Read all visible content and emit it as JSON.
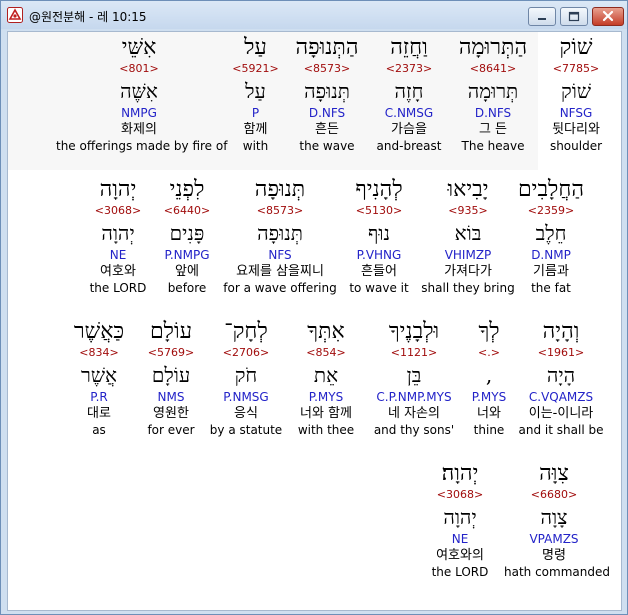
{
  "window": {
    "title": "@원전분해 - 레 10:15",
    "buttons": [
      "minimize",
      "maximize",
      "close"
    ]
  },
  "colors": {
    "strong_number": "#a10d0d",
    "morphology": "#2323c8",
    "text": "#000000"
  },
  "rows": [
    {
      "words": [
        {
          "hebrew": "שׁוֹק",
          "strong": "<7785>",
          "lemma": "שׁוֹק",
          "morph": "NFSG",
          "korean": "뒷다리와",
          "english": "shoulder"
        },
        {
          "hebrew": "הַתְּרוּמָה",
          "strong": "<8641>",
          "lemma": "תְּרוּמָה",
          "morph": "D.NFS",
          "korean": "그 든",
          "english": "The heave"
        },
        {
          "hebrew": "וַחֲזֵה",
          "strong": "<2373>",
          "lemma": "חָזֶה",
          "morph": "C.NMSG",
          "korean": "가슴을",
          "english": "and-breast"
        },
        {
          "hebrew": "הַתְּנוּפָה",
          "strong": "<8573>",
          "lemma": "תְּנוּפָה",
          "morph": "D.NFS",
          "korean": "흔든",
          "english": "the wave"
        },
        {
          "hebrew": "עַל",
          "strong": "<5921>",
          "lemma": "עַל",
          "morph": "P",
          "korean": "함께",
          "english": "with"
        },
        {
          "hebrew": "אִשֵּׁי",
          "strong": "<801>",
          "lemma": "אִשֶּׁה",
          "morph": "NMPG",
          "korean": "화제의",
          "english": "the offerings made by fire of"
        }
      ]
    },
    {
      "words": [
        {
          "hebrew": "הַחֲלָבִים",
          "strong": "<2359>",
          "lemma": "חֵלֶב",
          "morph": "D.NMP",
          "korean": "기름과",
          "english": "the fat"
        },
        {
          "hebrew": "יָבִיאוּ",
          "strong": "<935>",
          "lemma": "בּוֹא",
          "morph": "VHIMZP",
          "korean": "가져다가",
          "english": "shall they bring"
        },
        {
          "hebrew": "לְהָנִיף",
          "strong": "<5130>",
          "lemma": "נוּף",
          "morph": "P.VHNG",
          "korean": "흔들어",
          "english": "to wave it"
        },
        {
          "hebrew": "תְּנוּפָה",
          "strong": "<8573>",
          "lemma": "תְּנוּפָה",
          "morph": "NFS",
          "korean": "요제를 삼을찌니",
          "english": "for a wave offering"
        },
        {
          "hebrew": "לִפְנֵי",
          "strong": "<6440>",
          "lemma": "פָּנִים",
          "morph": "P.NMPG",
          "korean": "앞에",
          "english": "before"
        },
        {
          "hebrew": "יְהוָה",
          "strong": "<3068>",
          "lemma": "יְהוָה",
          "morph": "NE",
          "korean": "여호와",
          "english": "the LORD"
        }
      ]
    },
    {
      "words": [
        {
          "hebrew": "וְהָיָה",
          "strong": "<1961>",
          "lemma": "הָיָה",
          "morph": "C.VQAMZS",
          "korean": "이는-이니라",
          "english": "and it shall be"
        },
        {
          "hebrew": "לְךָ",
          "strong": "<.>",
          "lemma": ",",
          "morph": "P.MYS",
          "korean": "너와",
          "english": "thine"
        },
        {
          "hebrew": "וּלְבָנֶיךָ",
          "strong": "<1121>",
          "lemma": "בֵּן",
          "morph": "C.P.NMP.MYS",
          "korean": "네 자손의",
          "english": "and thy sons'"
        },
        {
          "hebrew": "אִתְּךָ",
          "strong": "<854>",
          "lemma": "אֵת",
          "morph": "P.MYS",
          "korean": "너와 함께",
          "english": "with thee"
        },
        {
          "hebrew": "לְחָק־",
          "strong": "<2706>",
          "lemma": "חֹק",
          "morph": "P.NMSG",
          "korean": "응식",
          "english": "by a statute"
        },
        {
          "hebrew": "עוֹלָם",
          "strong": "<5769>",
          "lemma": "עוֹלָם",
          "morph": "NMS",
          "korean": "영원한",
          "english": "for ever"
        },
        {
          "hebrew": "כַּאֲשֶׁר",
          "strong": "<834>",
          "lemma": "אֲשֶׁר",
          "morph": "P.R",
          "korean": "대로",
          "english": "as"
        }
      ]
    },
    {
      "words": [
        {
          "hebrew": "צִוָּה",
          "strong": "<6680>",
          "lemma": "צָוָה",
          "morph": "VPAMZS",
          "korean": "명령",
          "english": "hath commanded"
        },
        {
          "hebrew": "יְהוָה׃",
          "strong": "<3068>",
          "lemma": "יְהוָה",
          "morph": "NE",
          "korean": "여호와의",
          "english": "the LORD"
        }
      ]
    }
  ]
}
